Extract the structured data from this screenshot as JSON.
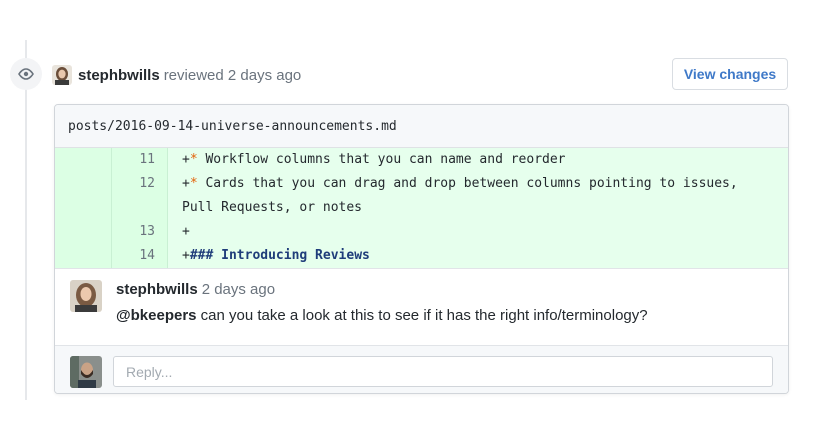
{
  "review": {
    "author": "stephbwills",
    "action": "reviewed",
    "time": "2 days ago",
    "view_changes_label": "View changes"
  },
  "file": {
    "path": "posts/2016-09-14-universe-announcements.md"
  },
  "diff": {
    "lines": [
      {
        "num": "11",
        "marker": "+",
        "star": "*",
        "text": " Workflow columns that you can name and reorder"
      },
      {
        "num": "12",
        "marker": "+",
        "star": "*",
        "text": " Cards that you can drag and drop between columns pointing to issues,\nPull Requests, or notes"
      },
      {
        "num": "13",
        "marker": "+",
        "star": "",
        "text": ""
      },
      {
        "num": "14",
        "marker": "+",
        "star": "",
        "text": "### Introducing Reviews"
      }
    ]
  },
  "comment": {
    "author": "stephbwills",
    "time": "2 days ago",
    "mention": "@bkeepers",
    "body": " can you take a look at this to see if it has the right info/terminology?"
  },
  "reply": {
    "placeholder": "Reply..."
  },
  "colors": {
    "diff_add_bg": "#e6ffed",
    "link_blue": "#3f79c8"
  }
}
